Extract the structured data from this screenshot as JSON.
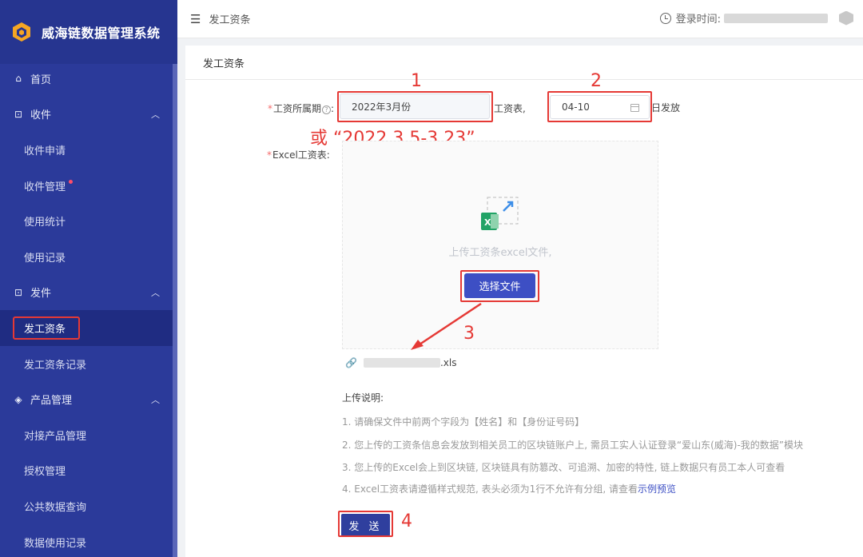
{
  "app": {
    "name": "威海链数据管理系统"
  },
  "sidebar": {
    "items": [
      {
        "label": "首页",
        "icon": "home-icon",
        "level": "top"
      },
      {
        "label": "收件",
        "icon": "inbox-icon",
        "level": "top",
        "expanded": true
      },
      {
        "label": "收件申请",
        "level": "sub"
      },
      {
        "label": "收件管理",
        "level": "sub",
        "badge_dot": true
      },
      {
        "label": "使用统计",
        "level": "sub"
      },
      {
        "label": "使用记录",
        "level": "sub"
      },
      {
        "label": "发件",
        "icon": "send-icon",
        "level": "top",
        "expanded": true
      },
      {
        "label": "发工资条",
        "level": "sub",
        "active": true
      },
      {
        "label": "发工资条记录",
        "level": "sub"
      },
      {
        "label": "产品管理",
        "icon": "cube-icon",
        "level": "top",
        "expanded": true
      },
      {
        "label": "对接产品管理",
        "level": "sub"
      },
      {
        "label": "授权管理",
        "level": "sub"
      },
      {
        "label": "公共数据查询",
        "level": "sub"
      },
      {
        "label": "数据使用记录",
        "level": "sub"
      }
    ]
  },
  "topbar": {
    "title": "发工资条",
    "login_label": "登录时间:"
  },
  "page": {
    "title": "发工资条"
  },
  "form": {
    "period_label": "工资所属期",
    "period_value": "2022年3月份",
    "payroll_suffix": "工资表,",
    "date_value": "04-10",
    "date_suffix": "日发放",
    "excel_label": "Excel工资表:",
    "upload_hint": "上传工资条excel文件,",
    "choose_file": "选择文件",
    "file_name_suffix": ".xls",
    "notes_title": "上传说明:",
    "notes": [
      "1. 请确保文件中前两个字段为【姓名】和【身份证号码】",
      "2. 您上传的工资条信息会发放到相关员工的区块链账户上, 需员工实人认证登录“爱山东(威海)-我的数据”模块",
      "3. 您上传的Excel会上到区块链, 区块链具有防篡改、可追溯、加密的特性, 链上数据只有员工本人可查看",
      "4. Excel工资表请遵循样式规范, 表头必须为1行不允许有分组, 请查看"
    ],
    "example_link": "示例预览",
    "send_button": "发 送"
  },
  "annotations": {
    "n1": "1",
    "n2": "2",
    "n3": "3",
    "n4": "4",
    "alt_note": "或 “2022.3.5-3.23”",
    "color": "#e53935"
  },
  "colors": {
    "sidebar": "#2b3a9a",
    "primary": "#3d4fc4"
  }
}
